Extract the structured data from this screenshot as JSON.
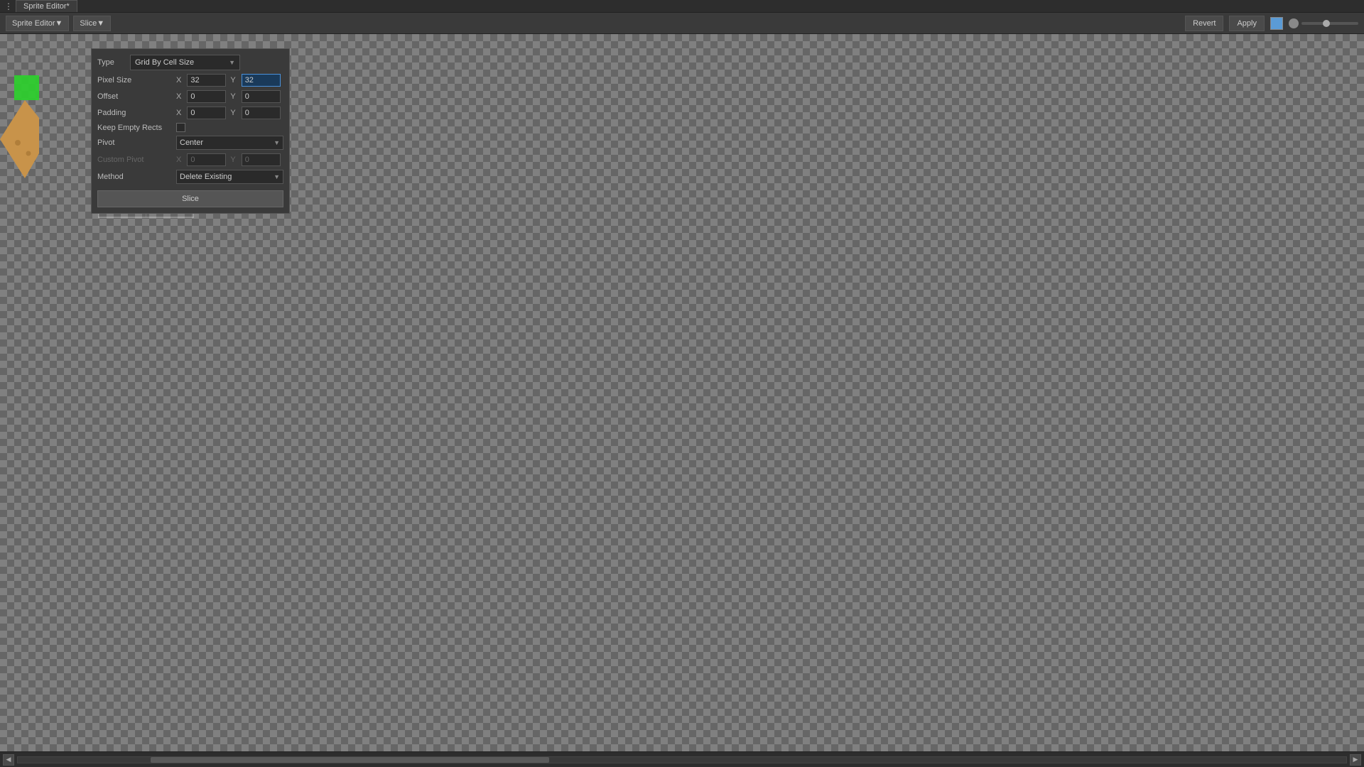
{
  "window": {
    "title": "Sprite Editor*",
    "tab_dots": "⋮"
  },
  "toolbar": {
    "sprite_editor_label": "Sprite Editor▼",
    "slice_label": "Slice▼",
    "revert_label": "Revert",
    "apply_label": "Apply"
  },
  "slice_panel": {
    "type_label": "Type",
    "type_value": "Grid By Cell Size",
    "pixel_size_label": "Pixel Size",
    "pixel_size_x_label": "X",
    "pixel_size_x_value": "32",
    "pixel_size_y_label": "Y",
    "pixel_size_y_value": "32",
    "offset_label": "Offset",
    "offset_x_label": "X",
    "offset_x_value": "0",
    "offset_y_label": "Y",
    "offset_y_value": "0",
    "padding_label": "Padding",
    "padding_x_label": "X",
    "padding_x_value": "0",
    "padding_y_label": "Y",
    "padding_y_value": "0",
    "keep_empty_label": "Keep Empty Rects",
    "pivot_label": "Pivot",
    "pivot_value": "Center",
    "custom_pivot_label": "Custom Pivot",
    "custom_pivot_x_label": "X",
    "custom_pivot_x_value": "0",
    "custom_pivot_y_label": "Y",
    "custom_pivot_y_value": "0",
    "method_label": "Method",
    "method_value": "Delete Existing",
    "slice_button_label": "Slice"
  },
  "colors": {
    "accent": "#4a90d9",
    "background": "#3c3c3c",
    "panel_bg": "#3a3a3a",
    "sprite_tan": "#C8934A",
    "sprite_green": "#3adb3a",
    "grid_line": "rgba(255,255,255,0.4)"
  }
}
